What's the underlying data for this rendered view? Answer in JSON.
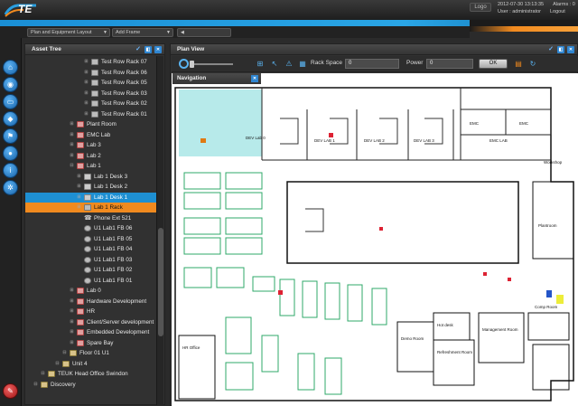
{
  "header": {
    "logo_text": "TE",
    "logo_button": "Logo",
    "datetime": "2012-07-30 13:13:35",
    "alarms": "Alarms : 0",
    "user": "User : administrator",
    "logout": "Logout"
  },
  "framebar": {
    "layout_select": "Plan and Equipment Layout",
    "frame_select": "Add Frame",
    "nav_arrows": "◀"
  },
  "asset_tree": {
    "title": "Asset Tree",
    "items": [
      {
        "label": "Test Row Rack 07",
        "icon": "rack-icon"
      },
      {
        "label": "Test Row Rack 06",
        "icon": "rack-icon"
      },
      {
        "label": "Test Row Rack 05",
        "icon": "rack-icon"
      },
      {
        "label": "Test Row Rack 03",
        "icon": "rack-icon"
      },
      {
        "label": "Test Row Rack 02",
        "icon": "rack-icon"
      },
      {
        "label": "Test Row Rack 01",
        "icon": "rack-icon"
      },
      {
        "label": "Plant Room",
        "icon": "room-icon"
      },
      {
        "label": "EMC Lab",
        "icon": "room-icon"
      },
      {
        "label": "Lab 3",
        "icon": "room-icon"
      },
      {
        "label": "Lab 2",
        "icon": "room-icon"
      },
      {
        "label": "Lab 1",
        "icon": "room-icon"
      },
      {
        "label": "Lab 1 Desk 3",
        "icon": "desk-icon"
      },
      {
        "label": "Lab 1 Desk 2",
        "icon": "desk-icon"
      },
      {
        "label": "Lab 1 Desk 1",
        "icon": "desk-icon"
      },
      {
        "label": "Lab 1 Rack",
        "icon": "rack-icon"
      },
      {
        "label": "Phone Ext 521",
        "icon": "phone-icon"
      },
      {
        "label": "U1 Lab1 FB 06",
        "icon": "floorbox-icon"
      },
      {
        "label": "U1 Lab1 FB 05",
        "icon": "floorbox-icon"
      },
      {
        "label": "U1 Lab1 FB 04",
        "icon": "floorbox-icon"
      },
      {
        "label": "U1 Lab1 FB 03",
        "icon": "floorbox-icon"
      },
      {
        "label": "U1 Lab1 FB 02",
        "icon": "floorbox-icon"
      },
      {
        "label": "U1 Lab1 FB 01",
        "icon": "floorbox-icon"
      },
      {
        "label": "Lab 0",
        "icon": "room-icon"
      },
      {
        "label": "Hardware Development",
        "icon": "room-icon"
      },
      {
        "label": "HR",
        "icon": "room-icon"
      },
      {
        "label": "Client/Server development",
        "icon": "room-icon"
      },
      {
        "label": "Embedded Development",
        "icon": "room-icon"
      },
      {
        "label": "Spare Bay",
        "icon": "room-icon"
      },
      {
        "label": "Floor 01 U1",
        "icon": "floor-icon"
      },
      {
        "label": "Unit 4",
        "icon": "building-icon"
      },
      {
        "label": "TEUK Head Office Swindon",
        "icon": "building-icon"
      },
      {
        "label": "Discovery",
        "icon": "site-icon"
      }
    ]
  },
  "plan_view": {
    "title": "Plan View",
    "rack_space_label": "Rack Space",
    "rack_space_value": "0",
    "power_label": "Power",
    "power_value": "0",
    "ok_label": "OK",
    "navigation_title": "Navigation",
    "rooms": {
      "dev_lab_0": "DEV Lab 0",
      "dev_lab_1": "DEV LAB 1",
      "dev_lab_2": "DEV LAB 2",
      "dev_lab_3": "DEV LAB 3",
      "emc_lab": "EMC LAB",
      "emc_1": "EMC",
      "emc_2": "EMC",
      "workshop": "Workshop",
      "plantroom": "Plantroom",
      "hr_office": "HR Office",
      "demo_room": "Demo Room",
      "hot_desk": "Hot desk",
      "refreshment_room": "Refreshment Room",
      "management_room": "Management Room",
      "comp_room": "Comp Room"
    }
  },
  "colors": {
    "accent_blue": "#1e8fd2",
    "accent_orange": "#f08a1f",
    "nav_highlight": "#8fe0e0"
  }
}
